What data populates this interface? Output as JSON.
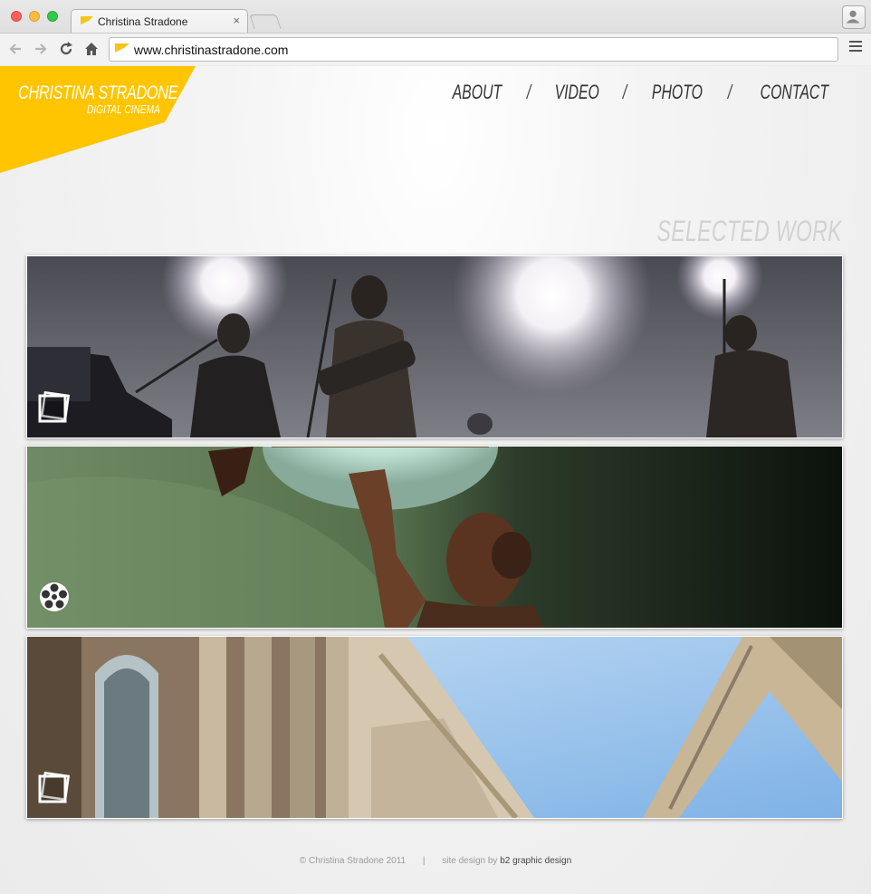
{
  "browser": {
    "tab_title": "Christina Stradone",
    "tab_close": "×",
    "url": "www.christinastradone.com",
    "accent_color": "#f5c518"
  },
  "site": {
    "logo_name": "CHRISTINA STRADONE",
    "logo_subtitle": "DIGITAL CINEMA",
    "brand_color": "#ffc500",
    "nav": [
      {
        "label": "ABOUT"
      },
      {
        "label": "VIDEO"
      },
      {
        "label": "PHOTO"
      },
      {
        "label": "CONTACT"
      }
    ],
    "nav_separator": "/",
    "section_title": "SELECTED WORK",
    "panels": [
      {
        "subject": "concert band silhouette with stage lights",
        "icon": "photo-stack-icon"
      },
      {
        "subject": "bronze statue holding stained glass lamp",
        "icon": "film-reel-icon"
      },
      {
        "subject": "ornate building facade against blue sky",
        "icon": "photo-stack-icon"
      }
    ]
  },
  "footer": {
    "copyright": "© Christina Stradone 2011",
    "separator": "|",
    "credit_prefix": "site design by",
    "credit_name": "b2 graphic design"
  }
}
